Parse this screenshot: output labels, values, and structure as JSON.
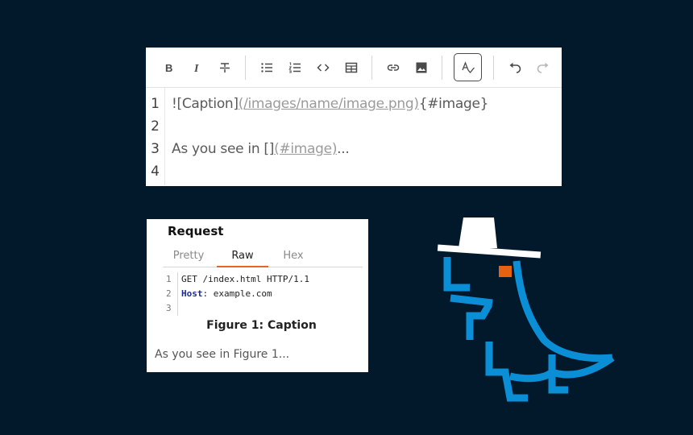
{
  "editor": {
    "toolbar": [
      {
        "name": "bold-button",
        "icon": "bold-icon",
        "state": "normal"
      },
      {
        "name": "italic-button",
        "icon": "italic-icon",
        "state": "normal"
      },
      {
        "name": "strikethrough-button",
        "icon": "strikethrough-icon",
        "state": "normal"
      },
      {
        "name": "bullet-list-button",
        "icon": "bullet-list-icon",
        "state": "normal"
      },
      {
        "name": "numbered-list-button",
        "icon": "numbered-list-icon",
        "state": "normal"
      },
      {
        "name": "code-button",
        "icon": "code-icon",
        "state": "normal"
      },
      {
        "name": "table-button",
        "icon": "table-icon",
        "state": "normal"
      },
      {
        "name": "link-button",
        "icon": "link-icon",
        "state": "normal"
      },
      {
        "name": "image-button",
        "icon": "image-icon",
        "state": "normal"
      },
      {
        "name": "spellcheck-button",
        "icon": "spellcheck-icon",
        "state": "active"
      },
      {
        "name": "undo-button",
        "icon": "undo-icon",
        "state": "normal"
      },
      {
        "name": "redo-button",
        "icon": "redo-icon",
        "state": "disabled"
      }
    ],
    "line_numbers": [
      "1",
      "2",
      "3",
      "4"
    ],
    "line1": {
      "prefix": "![Caption]",
      "link": "(/images/name/image.png)",
      "suffix": "{#image}"
    },
    "line3": {
      "prefix": "As you see in ",
      "brackets": "[]",
      "link": "(#image)",
      "suffix": "..."
    }
  },
  "preview": {
    "title": "Request",
    "tabs": [
      {
        "label": "Pretty",
        "active": false
      },
      {
        "label": "Raw",
        "active": true
      },
      {
        "label": "Hex",
        "active": false
      }
    ],
    "code_lines": [
      {
        "num": "1",
        "key": "",
        "text": "GET /index.html HTTP/1.1"
      },
      {
        "num": "2",
        "key": "Host",
        "text": ": example.com"
      },
      {
        "num": "3",
        "key": "",
        "text": ""
      }
    ],
    "caption": "Figure 1: Caption",
    "body_text": "As you see in Figure 1..."
  },
  "colors": {
    "background": "#02182b",
    "tab_underline": "#e8632a",
    "mascot_blue": "#0a8fd6",
    "mascot_eye": "#e5630f",
    "hat": "#ffffff"
  },
  "mascot": {
    "icon": "dino-detective-mascot"
  }
}
